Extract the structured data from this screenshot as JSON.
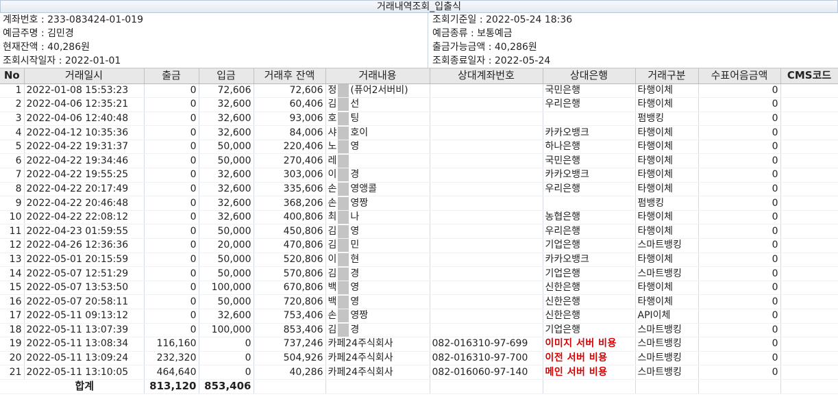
{
  "title": "거래내역조회_입출식",
  "info": {
    "left": [
      "계좌번호 : 233-083424-01-019",
      "예금주명 : 김민경",
      "현재잔액 : 40,286원",
      "조회시작일자 : 2022-01-01"
    ],
    "right": [
      "조회기준일 : 2022-05-24 18:36",
      "예금종류 : 보통예금",
      "출금가능금액 : 40,286원",
      "조회종료일자 : 2022-05-24"
    ]
  },
  "columns": [
    "No",
    "거래일시",
    "출금",
    "입금",
    "거래후 잔액",
    "거래내용",
    "상대계좌번호",
    "상대은행",
    "거래구분",
    "수표어음금액",
    "CMS코드"
  ],
  "rows": [
    {
      "no": "1",
      "datetime": "2022-01-08 15:53:23",
      "out": "0",
      "in": "72,606",
      "balance": "72,606",
      "desc_a": "정",
      "desc_b": "(퓨어2서버비)",
      "account": "",
      "bank": "국민은행",
      "type": "타행이체",
      "check": "0"
    },
    {
      "no": "2",
      "datetime": "2022-04-06 12:35:21",
      "out": "0",
      "in": "32,600",
      "balance": "60,406",
      "desc_a": "김",
      "desc_b": "선",
      "account": "",
      "bank": "우리은행",
      "type": "타행이체",
      "check": "0"
    },
    {
      "no": "3",
      "datetime": "2022-04-06 12:40:48",
      "out": "0",
      "in": "32,600",
      "balance": "93,006",
      "desc_a": "호",
      "desc_b": "팅",
      "account": "",
      "bank": "",
      "type": "펌뱅킹",
      "check": "0"
    },
    {
      "no": "4",
      "datetime": "2022-04-12 10:35:36",
      "out": "0",
      "in": "32,600",
      "balance": "84,006",
      "desc_a": "샤",
      "desc_b": "호이",
      "account": "",
      "bank": "카카오뱅크",
      "type": "타행이체",
      "check": "0"
    },
    {
      "no": "5",
      "datetime": "2022-04-22 19:31:37",
      "out": "0",
      "in": "50,000",
      "balance": "220,406",
      "desc_a": "노",
      "desc_b": "영",
      "account": "",
      "bank": "하나은행",
      "type": "타행이체",
      "check": "0"
    },
    {
      "no": "6",
      "datetime": "2022-04-22 19:34:46",
      "out": "0",
      "in": "50,000",
      "balance": "270,406",
      "desc_a": "레",
      "desc_b": "",
      "account": "",
      "bank": "국민은행",
      "type": "타행이체",
      "check": "0"
    },
    {
      "no": "7",
      "datetime": "2022-04-22 19:55:25",
      "out": "0",
      "in": "32,600",
      "balance": "303,006",
      "desc_a": "이",
      "desc_b": "경",
      "account": "",
      "bank": "카카오뱅크",
      "type": "타행이체",
      "check": "0"
    },
    {
      "no": "8",
      "datetime": "2022-04-22 20:17:49",
      "out": "0",
      "in": "32,600",
      "balance": "335,606",
      "desc_a": "손",
      "desc_b": "영앵콜",
      "account": "",
      "bank": "우리은행",
      "type": "타행이체",
      "check": "0"
    },
    {
      "no": "9",
      "datetime": "2022-04-22 20:46:48",
      "out": "0",
      "in": "32,600",
      "balance": "368,206",
      "desc_a": "손",
      "desc_b": "영짱",
      "account": "",
      "bank": "",
      "type": "펌뱅킹",
      "check": "0"
    },
    {
      "no": "10",
      "datetime": "2022-04-22 22:08:12",
      "out": "0",
      "in": "32,600",
      "balance": "400,806",
      "desc_a": "최",
      "desc_b": "나",
      "account": "",
      "bank": "농협은행",
      "type": "타행이체",
      "check": "0"
    },
    {
      "no": "11",
      "datetime": "2022-04-23 01:59:55",
      "out": "0",
      "in": "50,000",
      "balance": "450,806",
      "desc_a": "김",
      "desc_b": "영",
      "account": "",
      "bank": "우리은행",
      "type": "타행이체",
      "check": "0"
    },
    {
      "no": "12",
      "datetime": "2022-04-26 12:36:36",
      "out": "0",
      "in": "20,000",
      "balance": "470,806",
      "desc_a": "김",
      "desc_b": "민",
      "account": "",
      "bank": "기업은행",
      "type": "스마트뱅킹",
      "check": "0"
    },
    {
      "no": "13",
      "datetime": "2022-05-01 20:15:59",
      "out": "0",
      "in": "50,000",
      "balance": "520,806",
      "desc_a": "이",
      "desc_b": "현",
      "account": "",
      "bank": "카카오뱅크",
      "type": "타행이체",
      "check": "0"
    },
    {
      "no": "14",
      "datetime": "2022-05-07 12:51:29",
      "out": "0",
      "in": "50,000",
      "balance": "570,806",
      "desc_a": "김",
      "desc_b": "경",
      "account": "",
      "bank": "기업은행",
      "type": "스마트뱅킹",
      "check": "0"
    },
    {
      "no": "15",
      "datetime": "2022-05-07 13:53:50",
      "out": "0",
      "in": "100,000",
      "balance": "670,806",
      "desc_a": "백",
      "desc_b": "영",
      "account": "",
      "bank": "신한은행",
      "type": "타행이체",
      "check": "0"
    },
    {
      "no": "16",
      "datetime": "2022-05-07 20:58:11",
      "out": "0",
      "in": "50,000",
      "balance": "720,806",
      "desc_a": "백",
      "desc_b": "영",
      "account": "",
      "bank": "신한은행",
      "type": "타행이체",
      "check": "0"
    },
    {
      "no": "17",
      "datetime": "2022-05-11 09:13:12",
      "out": "0",
      "in": "32,600",
      "balance": "753,406",
      "desc_a": "손",
      "desc_b": "영짱",
      "account": "",
      "bank": "신한은행",
      "type": "API이체",
      "check": "0"
    },
    {
      "no": "18",
      "datetime": "2022-05-11 13:07:39",
      "out": "0",
      "in": "100,000",
      "balance": "853,406",
      "desc_a": "김",
      "desc_b": "경",
      "account": "",
      "bank": "기업은행",
      "type": "스마트뱅킹",
      "check": "0"
    },
    {
      "no": "19",
      "datetime": "2022-05-11 13:08:34",
      "out": "116,160",
      "in": "0",
      "balance": "737,246",
      "desc_a": "카페24주식회사",
      "desc_b": "",
      "account": "082-016310-97-699",
      "bank": "이미지 서버 비용",
      "type": "스마트뱅킹",
      "check": "0",
      "bank_red": true
    },
    {
      "no": "20",
      "datetime": "2022-05-11 13:09:24",
      "out": "232,320",
      "in": "0",
      "balance": "504,926",
      "desc_a": "카페24주식회사",
      "desc_b": "",
      "account": "082-016310-97-700",
      "bank": "이전 서버 비용",
      "type": "스마트뱅킹",
      "check": "0",
      "bank_red": true
    },
    {
      "no": "21",
      "datetime": "2022-05-11 13:10:05",
      "out": "464,640",
      "in": "0",
      "balance": "40,286",
      "desc_a": "카페24주식회사",
      "desc_b": "",
      "account": "082-016060-97-140",
      "bank": "메인 서버 비용",
      "type": "스마트뱅킹",
      "check": "0",
      "bank_red": true
    }
  ],
  "total": {
    "label": "합계",
    "out": "813,120",
    "in": "853,406"
  },
  "colors": {
    "highlight_red": "#d40000",
    "header_bg": "#e8e8e8",
    "mask_gray": "#c4c4c4"
  }
}
